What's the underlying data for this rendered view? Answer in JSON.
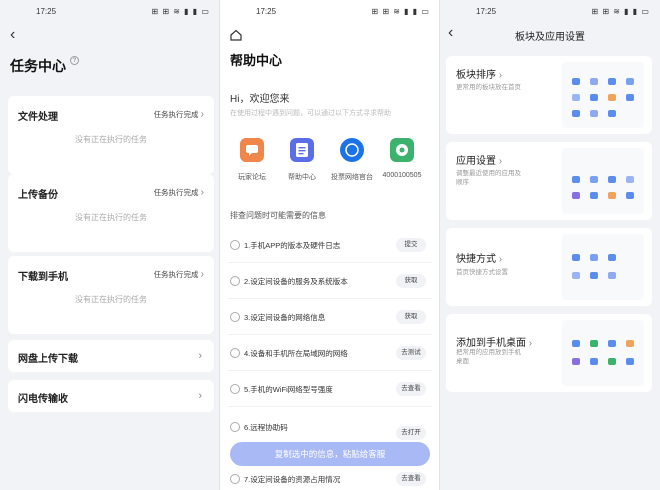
{
  "status": {
    "time": "17:25",
    "icons": "⊞ ⊞ ≋ ▮ ▮ ▭"
  },
  "screen1": {
    "title": "任务中心",
    "cards": [
      {
        "title": "文件处理",
        "link": "任务执行完成",
        "empty": "没有正在执行的任务"
      },
      {
        "title": "上传备份",
        "link": "任务执行完成",
        "empty": "没有正在执行的任务"
      },
      {
        "title": "下载到手机",
        "link": "任务执行完成",
        "empty": "没有正在执行的任务"
      }
    ],
    "rows": [
      {
        "title": "网盘上传下载"
      },
      {
        "title": "闪电传输收"
      }
    ]
  },
  "screen2": {
    "title": "帮助中心",
    "greeting": "Hi，欢迎您来",
    "greeting_sub": "在使用过程中遇到问题，可以通过以下方式寻求帮助",
    "apps": [
      {
        "label": "玩家论坛",
        "color": "#f0864a",
        "icon": "chat-icon"
      },
      {
        "label": "帮助中心",
        "color": "#5b6ee8",
        "icon": "document-icon"
      },
      {
        "label": "投票网络官台",
        "color": "#1a73e8",
        "icon": "circle-logo-icon"
      },
      {
        "label": "4000100505",
        "color": "#3bb36c",
        "icon": "phone-icon"
      }
    ],
    "section_label": "排查问题时可能需要的信息",
    "questions": [
      {
        "text": "1.手机APP的版本及硬件日志",
        "action": "提交"
      },
      {
        "text": "2.设定间设备的服务及系统版本",
        "action": "获取"
      },
      {
        "text": "3.设定间设备的网络信息",
        "action": "获取"
      },
      {
        "text": "4.设备和手机所在局域网的网络",
        "action": "去测试"
      },
      {
        "text": "5.手机的WiFi网络型号强度",
        "action": "去查看"
      },
      {
        "text": "6.远程协助码",
        "action": "去打开"
      },
      {
        "text": "7.设定间设备的资源占用情况",
        "action": "去查看"
      }
    ],
    "copy_button": "复制选中的信息，粘贴给客服"
  },
  "screen3": {
    "title": "板块及应用设置",
    "cards": [
      {
        "title": "板块排序",
        "desc": "更常用的板块放在首页"
      },
      {
        "title": "应用设置",
        "desc": "调整最近使用的应用及顺序"
      },
      {
        "title": "快捷方式",
        "desc": "首页快捷方式设置"
      },
      {
        "title": "添加到手机桌面",
        "desc": "把常用的应用放到手机桌面"
      }
    ]
  }
}
